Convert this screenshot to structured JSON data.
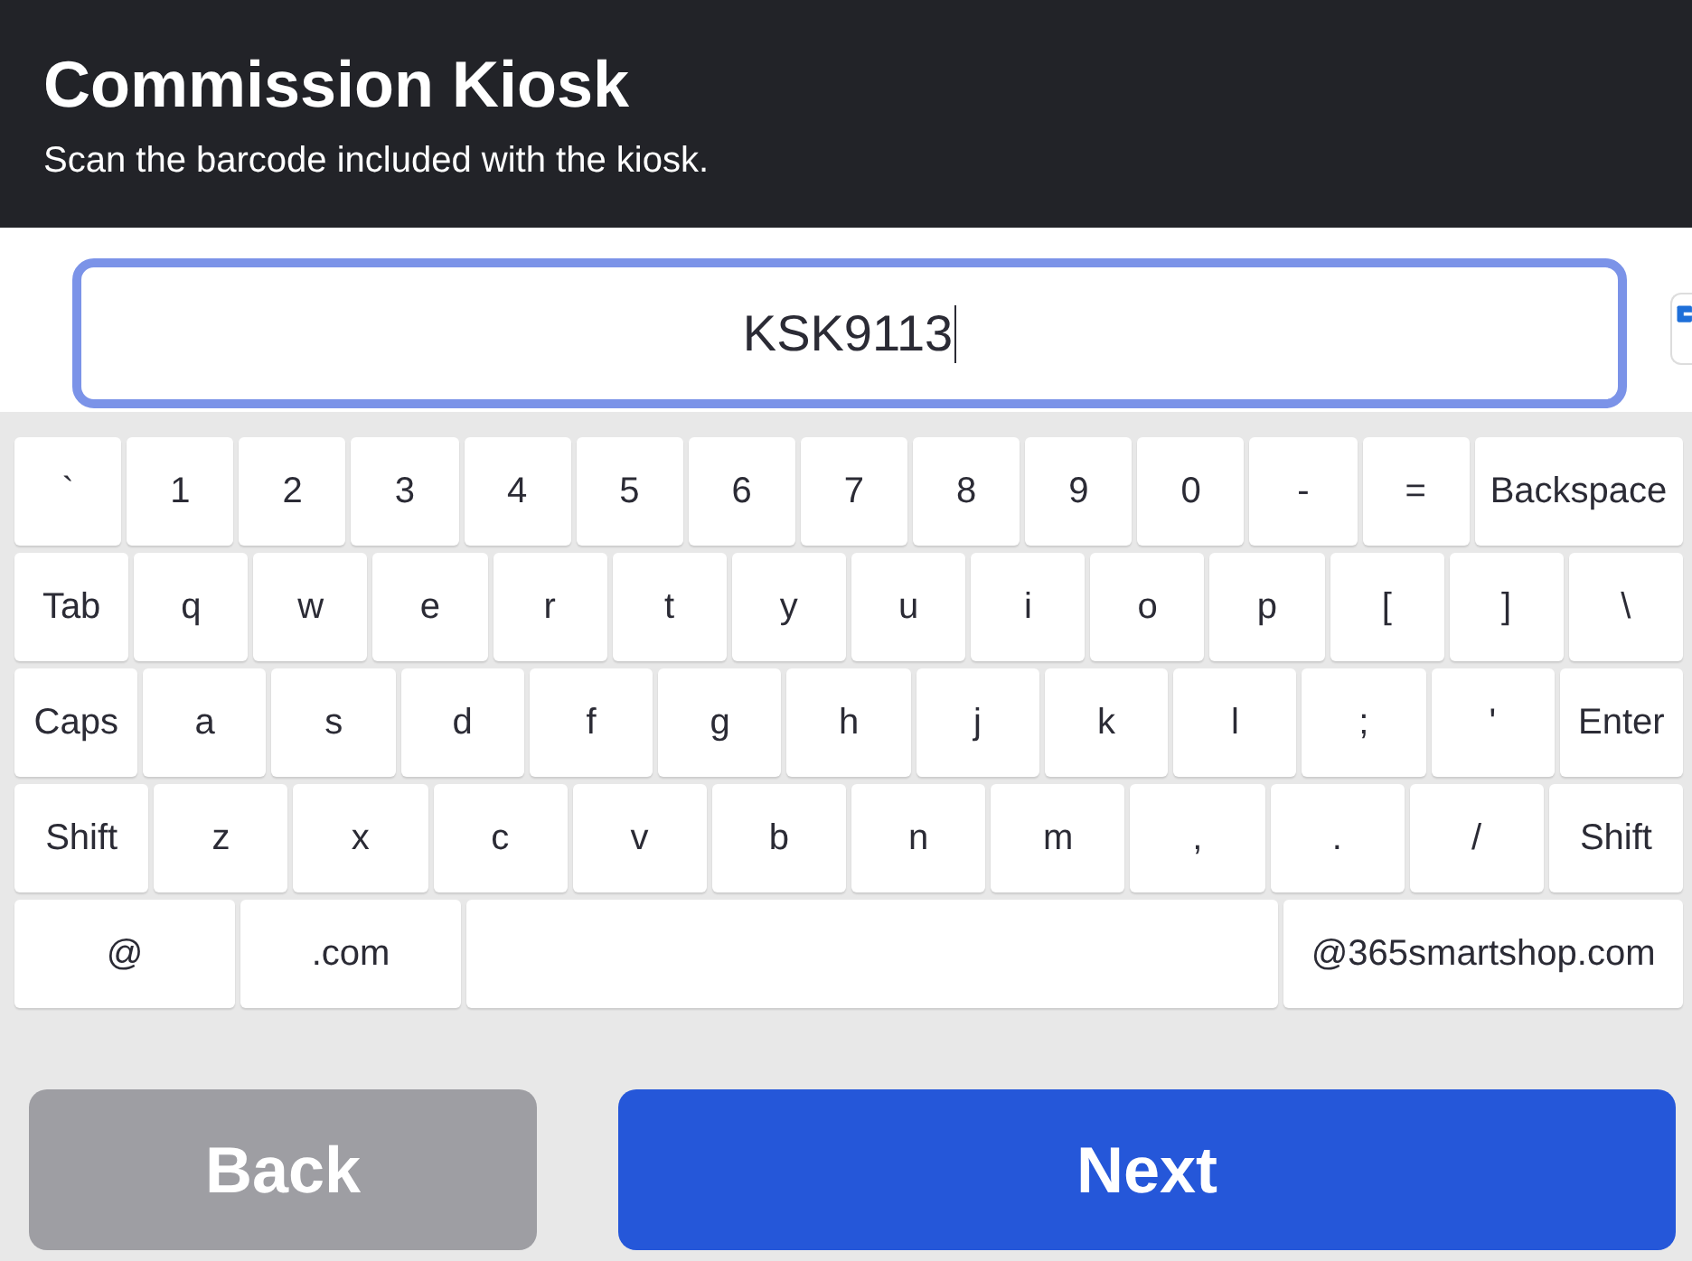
{
  "header": {
    "title": "Commission Kiosk",
    "subtitle": "Scan the barcode included with the kiosk."
  },
  "barcode_field": {
    "value": "KSK9113",
    "focused": true
  },
  "keyboard": {
    "key_rows": [
      {
        "keys": [
          {
            "label": "`",
            "kind": "key"
          },
          {
            "label": "1",
            "kind": "key"
          },
          {
            "label": "2",
            "kind": "key"
          },
          {
            "label": "3",
            "kind": "key"
          },
          {
            "label": "4",
            "kind": "key"
          },
          {
            "label": "5",
            "kind": "key"
          },
          {
            "label": "6",
            "kind": "key"
          },
          {
            "label": "7",
            "kind": "key"
          },
          {
            "label": "8",
            "kind": "key"
          },
          {
            "label": "9",
            "kind": "key"
          },
          {
            "label": "0",
            "kind": "key"
          },
          {
            "label": "-",
            "kind": "key"
          },
          {
            "label": "=",
            "kind": "key"
          },
          {
            "label": "Backspace",
            "kind": "wide"
          }
        ]
      },
      {
        "keys": [
          {
            "label": "Tab",
            "kind": "key"
          },
          {
            "label": "q",
            "kind": "key"
          },
          {
            "label": "w",
            "kind": "key"
          },
          {
            "label": "e",
            "kind": "key"
          },
          {
            "label": "r",
            "kind": "key"
          },
          {
            "label": "t",
            "kind": "key"
          },
          {
            "label": "y",
            "kind": "key"
          },
          {
            "label": "u",
            "kind": "key"
          },
          {
            "label": "i",
            "kind": "key"
          },
          {
            "label": "o",
            "kind": "key"
          },
          {
            "label": "p",
            "kind": "key"
          },
          {
            "label": "[",
            "kind": "key"
          },
          {
            "label": "]",
            "kind": "key"
          },
          {
            "label": "\\",
            "kind": "key"
          }
        ]
      },
      {
        "keys": [
          {
            "label": "Caps",
            "kind": "key"
          },
          {
            "label": "a",
            "kind": "key"
          },
          {
            "label": "s",
            "kind": "key"
          },
          {
            "label": "d",
            "kind": "key"
          },
          {
            "label": "f",
            "kind": "key"
          },
          {
            "label": "g",
            "kind": "key"
          },
          {
            "label": "h",
            "kind": "key"
          },
          {
            "label": "j",
            "kind": "key"
          },
          {
            "label": "k",
            "kind": "key"
          },
          {
            "label": "l",
            "kind": "key"
          },
          {
            "label": ";",
            "kind": "key"
          },
          {
            "label": "'",
            "kind": "key"
          },
          {
            "label": "Enter",
            "kind": "key"
          }
        ]
      },
      {
        "keys": [
          {
            "label": "Shift",
            "kind": "key"
          },
          {
            "label": "z",
            "kind": "key"
          },
          {
            "label": "x",
            "kind": "key"
          },
          {
            "label": "c",
            "kind": "key"
          },
          {
            "label": "v",
            "kind": "key"
          },
          {
            "label": "b",
            "kind": "key"
          },
          {
            "label": "n",
            "kind": "key"
          },
          {
            "label": "m",
            "kind": "key"
          },
          {
            "label": ",",
            "kind": "key"
          },
          {
            "label": ".",
            "kind": "key"
          },
          {
            "label": "/",
            "kind": "key"
          },
          {
            "label": "Shift",
            "kind": "key"
          }
        ]
      },
      {
        "keys": [
          {
            "label": "@",
            "kind": "key"
          },
          {
            "label": ".com",
            "kind": "key"
          },
          {
            "kind": "space"
          },
          {
            "label": "@365smartshop.com",
            "kind": "domain"
          }
        ]
      }
    ]
  },
  "buttons": [
    {
      "label": "Back",
      "kind": "secondary"
    },
    {
      "label": "Next",
      "kind": "primary"
    }
  ]
}
